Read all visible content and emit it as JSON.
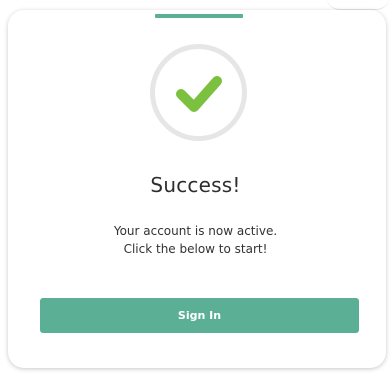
{
  "dialog": {
    "title": "Success!",
    "message_line1": "Your account is now active.",
    "message_line2": "Click the below to start!",
    "button_label": "Sign In",
    "icon": "checkmark-icon"
  },
  "colors": {
    "accent": "#5aaf95",
    "check": "#7cc03f",
    "ring": "#e6e6e6",
    "title": "#2e2e2e"
  }
}
